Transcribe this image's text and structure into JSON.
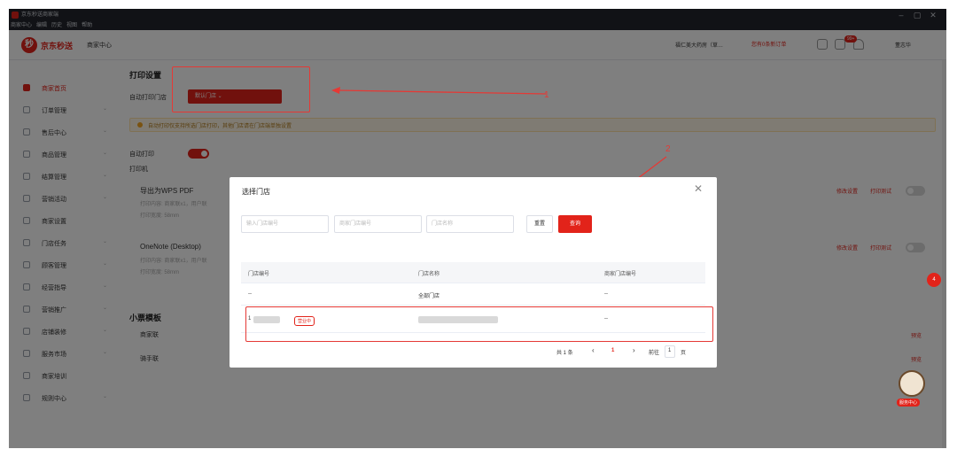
{
  "window": {
    "title": "京东秒送商家端",
    "menu": [
      "商家中心",
      "编辑",
      "历史",
      "视图",
      "帮助"
    ],
    "buttons": {
      "minimize": "–",
      "maximize": "▢",
      "close": "✕"
    }
  },
  "header": {
    "brand_name": "京东秒送",
    "brand_sub": "商家中心",
    "store_switch": "福仁美大药房（草…",
    "order_alert": "您有0条新订单",
    "bell_badge": "99+",
    "username": "董志华"
  },
  "sidebar": {
    "items": [
      {
        "label": "商家首页",
        "icon": "home-icon",
        "active": true
      },
      {
        "label": "订单管理",
        "icon": "order-icon"
      },
      {
        "label": "售后中心",
        "icon": "aftersale-icon"
      },
      {
        "label": "商品管理",
        "icon": "goods-icon"
      },
      {
        "label": "结算管理",
        "icon": "settlement-icon"
      },
      {
        "label": "营销活动",
        "icon": "marketing-icon"
      },
      {
        "label": "商家设置",
        "icon": "settings-icon"
      },
      {
        "label": "门店任务",
        "icon": "task-icon"
      },
      {
        "label": "顾客管理",
        "icon": "customer-icon"
      },
      {
        "label": "经营指导",
        "icon": "guide-icon"
      },
      {
        "label": "营销推广",
        "icon": "promotion-icon"
      },
      {
        "label": "店铺装修",
        "icon": "decoration-icon"
      },
      {
        "label": "服务市场",
        "icon": "market-icon"
      },
      {
        "label": "商家培训",
        "icon": "training-icon"
      },
      {
        "label": "规则中心",
        "icon": "rules-icon"
      }
    ]
  },
  "print_settings": {
    "section_title": "打印设置",
    "auto_store_label": "自动打印门店",
    "store_select_value": "默认门店",
    "warning": "自动打印仅支持所选门店打印，其他门店请在门店端单独设置",
    "auto_print_label": "自动打印",
    "printer_label": "打印机",
    "printers": [
      {
        "name": "导出为WPS PDF",
        "line1": "打印内容: 商家联x1，用户联",
        "line2": "打印宽度: 58mm",
        "settings": "修改设置",
        "test": "打印测试"
      },
      {
        "name": "OneNote (Desktop)",
        "line1": "打印内容: 商家联x1，用户联",
        "line2": "打印宽度: 58mm",
        "settings": "修改设置",
        "test": "打印测试"
      }
    ],
    "ticket_title": "小票模板",
    "tickets": [
      {
        "name": "商家联",
        "action": "预览"
      },
      {
        "name": "骑手联",
        "action": "预览"
      }
    ]
  },
  "annotations": {
    "one": "1",
    "two": "2"
  },
  "modal": {
    "title": "选择门店",
    "close": "✕",
    "inputs": [
      {
        "placeholder": "输入门店编号"
      },
      {
        "placeholder": "商家门店编号"
      },
      {
        "placeholder": "门店名称"
      }
    ],
    "reset": "重置",
    "query": "查询",
    "columns": [
      "门店编号",
      "门店名称",
      "商家门店编号"
    ],
    "rows": [
      {
        "id": "--",
        "name": "全部门店",
        "merchant_id": "--"
      },
      {
        "id": "1",
        "status": "营业中",
        "name": "",
        "merchant_id": "--"
      }
    ],
    "pager": {
      "total": "共 1 条",
      "prev": "‹",
      "page": "1",
      "next": "›",
      "goto": "前往",
      "goto_value": "1",
      "unit": "页"
    }
  },
  "floating": {
    "badge": "4",
    "service_label": "服务中心"
  },
  "colors": {
    "brand": "#e2231a",
    "warning_bg": "#fff7e6",
    "annotation": "#e53935"
  }
}
